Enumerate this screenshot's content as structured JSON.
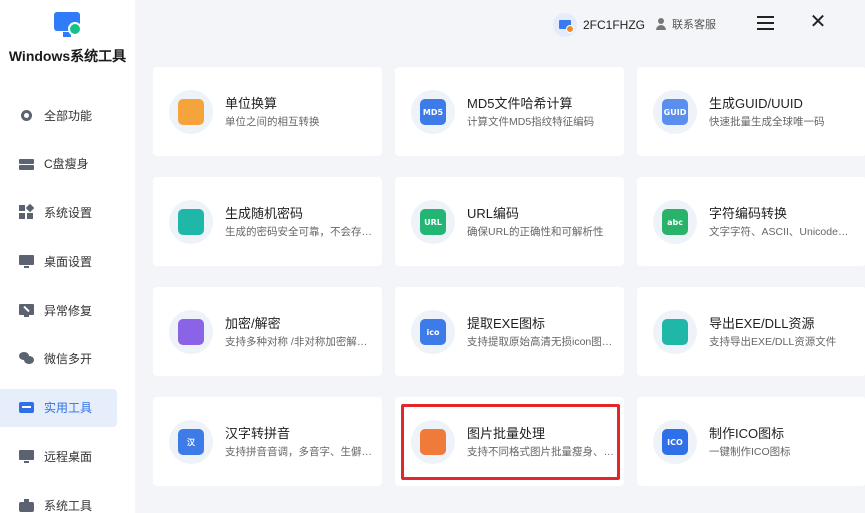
{
  "app": {
    "title": "Windows系统工具"
  },
  "header": {
    "device_id": "2FC1FHZG",
    "support_label": "联系客服"
  },
  "sidebar": {
    "items": [
      {
        "label": "全部功能",
        "icon": "gear-icon"
      },
      {
        "label": "C盘瘦身",
        "icon": "disk-icon"
      },
      {
        "label": "系统设置",
        "icon": "grid-icon"
      },
      {
        "label": "桌面设置",
        "icon": "monitor-icon"
      },
      {
        "label": "异常修复",
        "icon": "repair-icon"
      },
      {
        "label": "微信多开",
        "icon": "wechat-icon"
      },
      {
        "label": "实用工具",
        "icon": "toolbox-icon",
        "active": true
      },
      {
        "label": "远程桌面",
        "icon": "remote-icon"
      },
      {
        "label": "系统工具",
        "icon": "briefcase-icon"
      }
    ]
  },
  "cards": [
    {
      "title": "单位换算",
      "desc": "单位之间的相互转换",
      "icon": "calculator-icon",
      "icon_text": "",
      "color": "#f5a43b"
    },
    {
      "title": "MD5文件哈希计算",
      "desc": "计算文件MD5指纹特征编码",
      "icon": "md5-icon",
      "icon_text": "MD5",
      "color": "#3d7be8"
    },
    {
      "title": "生成GUID/UUID",
      "desc": "快速批量生成全球唯一码",
      "icon": "guid-icon",
      "icon_text": "GUID",
      "color": "#5b8fee"
    },
    {
      "title": "生成随机密码",
      "desc": "生成的密码安全可靠，不会存…",
      "icon": "lock-icon",
      "icon_text": "",
      "color": "#1fb8a8"
    },
    {
      "title": "URL编码",
      "desc": "确保URL的正确性和可解析性",
      "icon": "url-icon",
      "icon_text": "URL",
      "color": "#22b573"
    },
    {
      "title": "字符编码转换",
      "desc": "文字字符、ASCII、Unicode…",
      "icon": "abc-icon",
      "icon_text": "abc",
      "color": "#29b36a"
    },
    {
      "title": "加密/解密",
      "desc": "支持多种对称 /非对称加密解…",
      "icon": "database-icon",
      "icon_text": "",
      "color": "#8a63e6"
    },
    {
      "title": "提取EXE图标",
      "desc": "支持提取原始高清无损icon图…",
      "icon": "ico-extract-icon",
      "icon_text": "ico",
      "color": "#3d7be8"
    },
    {
      "title": "导出EXE/DLL资源",
      "desc": "支持导出EXE/DLL资源文件",
      "icon": "layers-icon",
      "icon_text": "",
      "color": "#1fb8a8"
    },
    {
      "title": "汉字转拼音",
      "desc": "支持拼音音调，多音字、生僻…",
      "icon": "pinyin-icon",
      "icon_text": "汉",
      "color": "#3d7be8"
    },
    {
      "title": "图片批量处理",
      "desc": "支持不同格式图片批量瘦身、…",
      "icon": "image-icon",
      "icon_text": "",
      "color": "#f07a3a"
    },
    {
      "title": "制作ICO图标",
      "desc": "一键制作ICO图标",
      "icon": "ico-make-icon",
      "icon_text": "ICO",
      "color": "#2f6fe8"
    }
  ]
}
